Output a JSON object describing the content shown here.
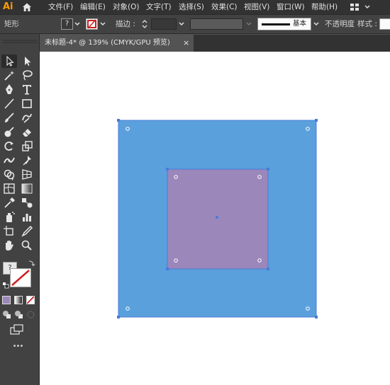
{
  "app": {
    "logo": "Ai"
  },
  "menu": [
    {
      "label": "文件(F)"
    },
    {
      "label": "编辑(E)"
    },
    {
      "label": "对象(O)"
    },
    {
      "label": "文字(T)"
    },
    {
      "label": "选择(S)"
    },
    {
      "label": "效果(C)"
    },
    {
      "label": "视图(V)"
    },
    {
      "label": "窗口(W)"
    },
    {
      "label": "帮助(H)"
    }
  ],
  "control_bar": {
    "selection_type": "矩形",
    "fill_placeholder": "?",
    "stroke_label": "描边 :",
    "brush_label": "基本",
    "opacity_label": "不透明度",
    "style_label": "样式 :"
  },
  "document_tab": {
    "title": "未标题-4* @ 139% (CMYK/GPU 预览)",
    "close": "×"
  },
  "toolbox": {
    "fill_placeholder": "?",
    "more_tools": "•••"
  },
  "colors": {
    "outer_square_fill": "#5aa0dc",
    "inner_square_fill": "#9b87ba",
    "selection_color": "#4a7bd8",
    "canvas_bg": "#ffffff",
    "ui_panel_bg": "#424242",
    "menu_bg": "#323232",
    "ai_logo": "#ff9a00"
  }
}
